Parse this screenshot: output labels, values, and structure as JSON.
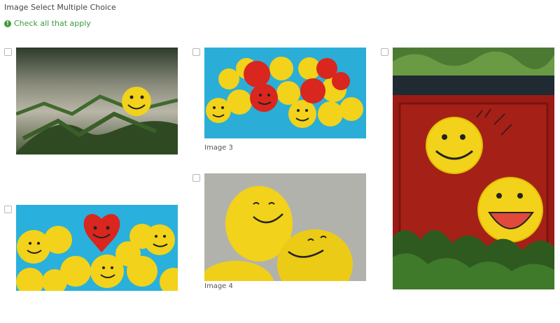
{
  "question": {
    "title": "Image Select Multiple Choice",
    "hint": "Check all that apply",
    "hint_icon": "!"
  },
  "options": [
    {
      "id": "image-1",
      "caption": ""
    },
    {
      "id": "image-2",
      "caption": ""
    },
    {
      "id": "image-3",
      "caption": "Image 3"
    },
    {
      "id": "image-4",
      "caption": "Image 4"
    },
    {
      "id": "image-5",
      "caption": ""
    }
  ],
  "colors": {
    "hint_green": "#3c9a3c",
    "smiley_yellow": "#f2d21a",
    "heart_red": "#d9261e",
    "sky_blue": "#2ab0dc"
  }
}
